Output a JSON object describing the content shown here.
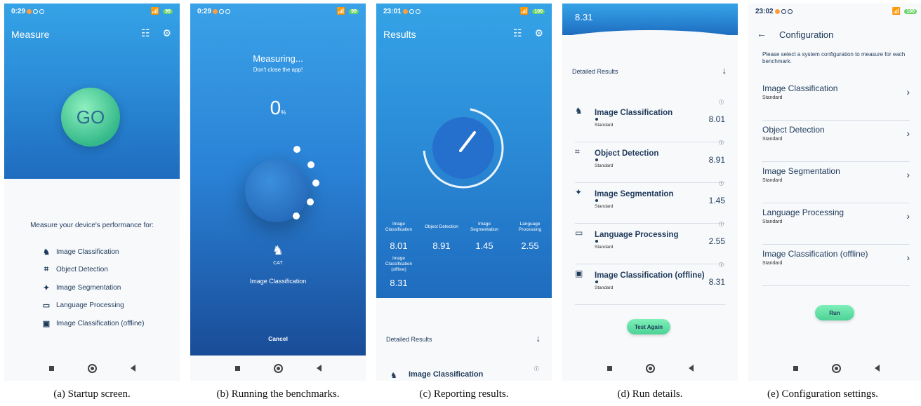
{
  "panels": {
    "a": {
      "time": "0:29",
      "battery": "99",
      "title": "Measure",
      "go": "GO",
      "prompt": "Measure your device's performance for:",
      "items": [
        "Image Classification",
        "Object Detection",
        "Image Segmentation",
        "Language Processing",
        "Image Classification (offline)"
      ],
      "caption": "(a) Startup screen."
    },
    "b": {
      "time": "0:29",
      "battery": "99",
      "heading": "Measuring...",
      "sub": "Don't close the app!",
      "progress": "0",
      "unit": "%",
      "cat_label": "CAT",
      "task": "Image Classification",
      "cancel": "Cancel",
      "caption": "(b) Running the benchmarks."
    },
    "c": {
      "time": "23:01",
      "battery": "100",
      "title": "Results",
      "results": [
        {
          "label": "Image Classification",
          "value": "8.01"
        },
        {
          "label": "Object Detection",
          "value": "8.91"
        },
        {
          "label": "Image Segmentation",
          "value": "1.45"
        },
        {
          "label": "Language Processing",
          "value": "2.55"
        },
        {
          "label": "Image Classification (offline)",
          "value": "8.31"
        }
      ],
      "detailed": "Detailed Results",
      "peek": "Image Classification",
      "caption": "(c) Reporting results."
    },
    "d": {
      "top_value": "8.31",
      "detailed": "Detailed Results",
      "rows": [
        {
          "name": "Image Classification",
          "config": "Standard",
          "value": "8.01"
        },
        {
          "name": "Object Detection",
          "config": "Standard",
          "value": "8.91"
        },
        {
          "name": "Image Segmentation",
          "config": "Standard",
          "value": "1.45"
        },
        {
          "name": "Language Processing",
          "config": "Standard",
          "value": "2.55"
        },
        {
          "name": "Image Classification (offline)",
          "config": "Standard",
          "value": "8.31"
        }
      ],
      "test_again": "Test Again",
      "caption": "(d) Run details."
    },
    "e": {
      "time": "23:02",
      "battery": "100",
      "title": "Configuration",
      "instructions": "Please select a system configuration to measure for each benchmark.",
      "items": [
        {
          "name": "Image Classification",
          "config": "Standard"
        },
        {
          "name": "Object Detection",
          "config": "Standard"
        },
        {
          "name": "Image Segmentation",
          "config": "Standard"
        },
        {
          "name": "Language Processing",
          "config": "Standard"
        },
        {
          "name": "Image Classification (offline)",
          "config": "Standard"
        }
      ],
      "run": "Run",
      "caption": "(e) Configuration settings."
    }
  },
  "colors": {
    "accent": "#2b8cd8",
    "button": "#4cd296",
    "text": "#1f3a5a"
  }
}
